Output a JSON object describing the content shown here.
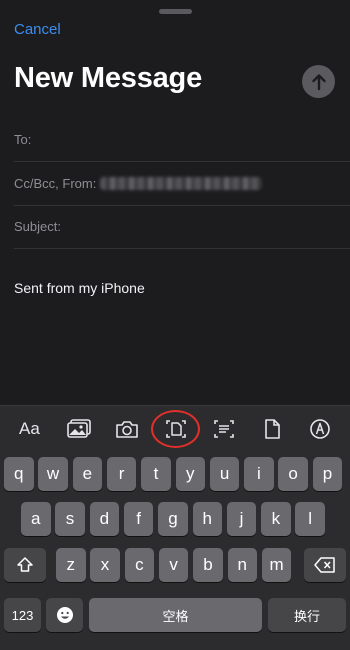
{
  "compose": {
    "cancel_label": "Cancel",
    "title": "New Message",
    "to_label": "To:",
    "cc_label": "Cc/Bcc, From:",
    "subject_label": "Subject:",
    "body": "Sent from my iPhone"
  },
  "toolbar": {
    "format_label": "Aa",
    "items": [
      "photo-library-icon",
      "camera-icon",
      "scan-document-icon",
      "scan-text-icon",
      "document-icon",
      "markup-icon"
    ],
    "highlighted_item": "scan-document-icon"
  },
  "keyboard": {
    "row1": [
      "q",
      "w",
      "e",
      "r",
      "t",
      "y",
      "u",
      "i",
      "o",
      "p"
    ],
    "row2": [
      "a",
      "s",
      "d",
      "f",
      "g",
      "h",
      "j",
      "k",
      "l"
    ],
    "row3": [
      "z",
      "x",
      "c",
      "v",
      "b",
      "n",
      "m"
    ],
    "numbers_label": "123",
    "space_label": "空格",
    "return_label": "换行"
  },
  "colors": {
    "accent": "#3b8ef0",
    "highlight_ring": "#e0302a",
    "background": "#1c1c1e",
    "keyboard_bg": "#2c2c2e"
  }
}
